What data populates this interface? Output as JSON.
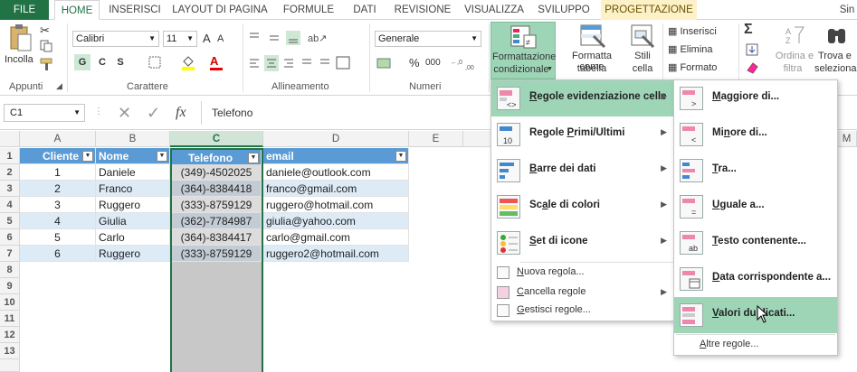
{
  "tabs": {
    "file": "FILE",
    "home": "HOME",
    "insert": "INSERISCI",
    "page_layout": "LAYOUT DI PAGINA",
    "formulas": "FORMULE",
    "data": "DATI",
    "review": "REVISIONE",
    "view": "VISUALIZZA",
    "developer": "SVILUPPO",
    "design": "PROGETTAZIONE",
    "user": "Sin"
  },
  "ribbon": {
    "paste_label": "Incolla",
    "clipboard_group": "Appunti",
    "font_name": "Calibri",
    "font_size": "11",
    "font_group": "Carattere",
    "bold": "G",
    "italic": "C",
    "underline": "S",
    "alignment_group": "Allineamento",
    "number_format": "Generale",
    "number_group": "Numeri",
    "percent": "%",
    "thousands": "000",
    "cf_label_1": "Formattazione",
    "cf_label_2": "condizionale",
    "format_table_1": "Formatta come",
    "format_table_2": "tabella",
    "cell_styles_1": "Stili",
    "cell_styles_2": "cella",
    "insert_btn": "Inserisci",
    "delete_btn": "Elimina",
    "format_btn": "Formato",
    "sort_1": "Ordina e",
    "sort_2": "filtra",
    "find_1": "Trova e",
    "find_2": "seleziona",
    "font_grow": "A",
    "font_shrink": "A",
    "sum_icon": "Σ"
  },
  "formula_bar": {
    "name_box": "C1",
    "fx": "fx",
    "content": "Telefono"
  },
  "columns": [
    "A",
    "B",
    "C",
    "D",
    "E",
    "M"
  ],
  "rows": [
    "1",
    "2",
    "3",
    "4",
    "5",
    "6",
    "7",
    "8",
    "9",
    "10",
    "11",
    "12",
    "13"
  ],
  "table": {
    "headers": [
      "Cliente",
      "Nome",
      "Telefono",
      "email"
    ],
    "rows": [
      [
        "1",
        "Daniele",
        "(349)-4502025",
        "daniele@outlook.com"
      ],
      [
        "2",
        "Franco",
        "(364)-8384418",
        "franco@gmail.com"
      ],
      [
        "3",
        "Ruggero",
        "(333)-8759129",
        "ruggero@hotmail.com"
      ],
      [
        "4",
        "Giulia",
        "(362)-7784987",
        "giulia@yahoo.com"
      ],
      [
        "5",
        "Carlo",
        "(364)-8384417",
        "carlo@gmail.com"
      ],
      [
        "6",
        "Ruggero",
        "(333)-8759129",
        "ruggero2@hotmail.com"
      ]
    ]
  },
  "cf_menu": {
    "items": [
      {
        "pre": "",
        "ul": "R",
        "post": "egole evidenziazione celle"
      },
      {
        "pre": "Regole ",
        "ul": "P",
        "post": "rimi/Ultimi"
      },
      {
        "pre": "",
        "ul": "B",
        "post": "arre dei dati"
      },
      {
        "pre": "Sc",
        "ul": "a",
        "post": "le di colori"
      },
      {
        "pre": "",
        "ul": "S",
        "post": "et di icone"
      }
    ],
    "small_items": [
      {
        "pre": "",
        "ul": "N",
        "post": "uova regola..."
      },
      {
        "pre": "",
        "ul": "C",
        "post": "ancella regole"
      },
      {
        "pre": "",
        "ul": "G",
        "post": "estisci regole..."
      }
    ]
  },
  "sub_menu": {
    "items": [
      {
        "pre": "",
        "ul": "M",
        "post": "aggiore di..."
      },
      {
        "pre": "Mi",
        "ul": "n",
        "post": "ore di..."
      },
      {
        "pre": "",
        "ul": "T",
        "post": "ra..."
      },
      {
        "pre": "",
        "ul": "U",
        "post": "guale a..."
      },
      {
        "pre": "",
        "ul": "T",
        "post": "esto contenente..."
      },
      {
        "pre": "",
        "ul": "D",
        "post": "ata corrispondente a..."
      },
      {
        "pre": "",
        "ul": "V",
        "post": "alori duplicati..."
      }
    ],
    "more_pre": "",
    "more_ul": "A",
    "more_post": "ltre regole..."
  },
  "colors": {
    "excel_green": "#217346",
    "table_header": "#5b9bd5",
    "table_band": "#ddebf7",
    "menu_highlight": "#9fd5b7",
    "selected_column": "#c8c8c8"
  }
}
